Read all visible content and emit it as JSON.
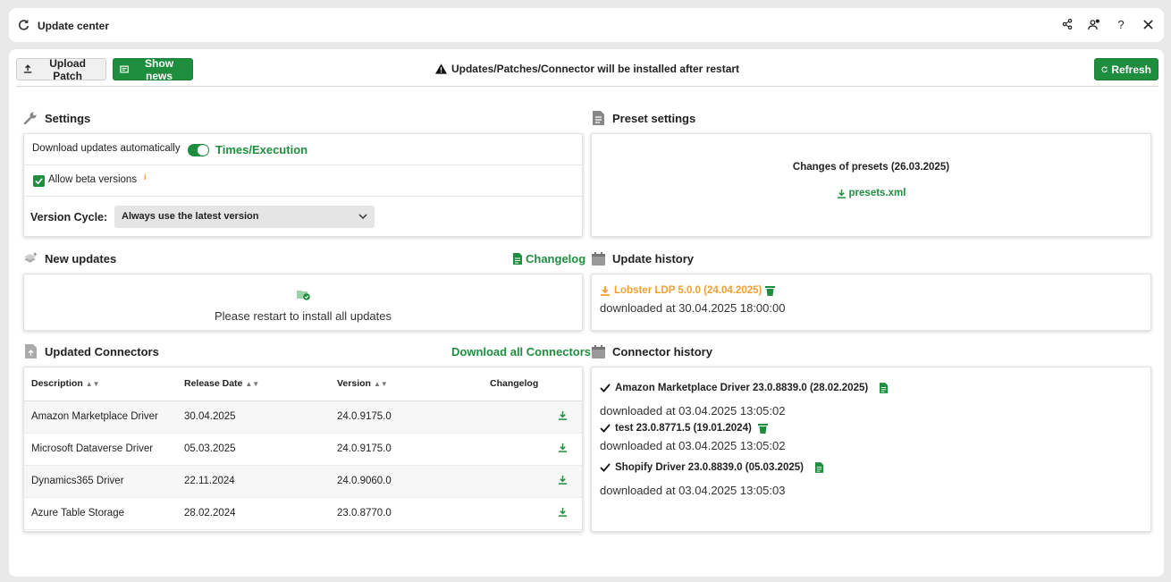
{
  "window": {
    "title": "Update center"
  },
  "toolbar": {
    "upload_patch": "Upload Patch",
    "show_news": "Show news",
    "notice": "Updates/Patches/Connector will be installed after restart",
    "refresh": "Refresh"
  },
  "settings": {
    "title": "Settings",
    "download_auto": "Download updates automatically",
    "times_execution": "Times/Execution",
    "allow_beta": "Allow beta versions",
    "version_cycle_label": "Version Cycle:",
    "version_cycle_value": "Always use the latest version"
  },
  "preset": {
    "title": "Preset settings",
    "changes": "Changes of presets (26.03.2025)",
    "file": "presets.xml"
  },
  "new_updates": {
    "title": "New updates",
    "changelog": "Changelog",
    "message": "Please restart to install all updates"
  },
  "update_history": {
    "title": "Update history",
    "entry_title": "Lobster LDP 5.0.0 (24.04.2025)",
    "entry_time": "downloaded at 30.04.2025 18:00:00"
  },
  "connectors": {
    "title": "Updated Connectors",
    "download_all": "Download all Connectors",
    "headers": {
      "description": "Description",
      "release": "Release Date",
      "version": "Version",
      "changelog": "Changelog"
    },
    "rows": [
      {
        "description": "Amazon Marketplace Driver",
        "release": "30.04.2025",
        "version": "24.0.9175.0"
      },
      {
        "description": "Microsoft Dataverse Driver",
        "release": "05.03.2025",
        "version": "24.0.9175.0"
      },
      {
        "description": "Dynamics365 Driver",
        "release": "22.11.2024",
        "version": "24.0.9060.0"
      },
      {
        "description": "Azure Table Storage",
        "release": "28.02.2024",
        "version": "23.0.8770.0"
      }
    ]
  },
  "connector_history": {
    "title": "Connector history",
    "entries": [
      {
        "name": "Amazon Marketplace Driver 23.0.8839.0 (28.02.2025)",
        "time": "downloaded at 03.04.2025 13:05:02"
      },
      {
        "name": "test 23.0.8771.5 (19.01.2024)",
        "time": "downloaded at 03.04.2025 13:05:02"
      },
      {
        "name": "Shopify Driver 23.0.8839.0 (05.03.2025)",
        "time": "downloaded at 03.04.2025 13:05:03"
      }
    ]
  },
  "colors": {
    "accent": "#1e8e3e",
    "orange": "#f0a030"
  }
}
